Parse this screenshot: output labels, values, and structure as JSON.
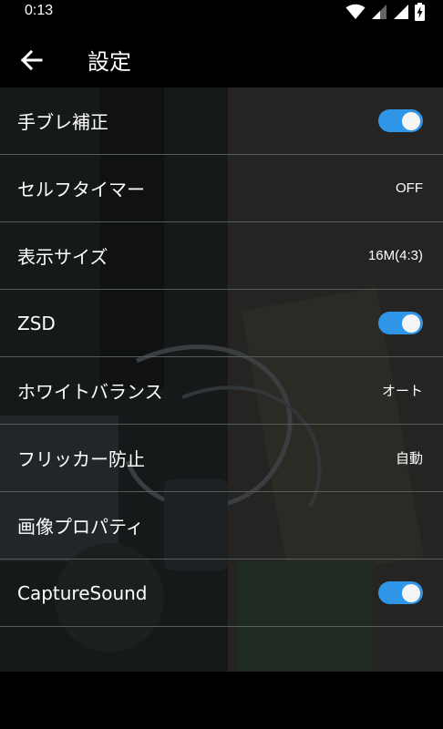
{
  "status_bar": {
    "time": "0:13",
    "icons": [
      "wifi-icon",
      "signal-icon",
      "signal-full-icon",
      "battery-charging-icon"
    ]
  },
  "app_bar": {
    "back_icon": "arrow-left-icon",
    "title": "設定"
  },
  "settings": [
    {
      "label": "手ブレ補正",
      "type": "toggle",
      "on": true
    },
    {
      "label": "セルフタイマー",
      "type": "value",
      "value": "OFF"
    },
    {
      "label": "表示サイズ",
      "type": "value",
      "value": "16M(4:3)"
    },
    {
      "label": "ZSD",
      "type": "toggle",
      "on": true
    },
    {
      "label": "ホワイトバランス",
      "type": "value",
      "value": "オート"
    },
    {
      "label": "フリッカー防止",
      "type": "value",
      "value": "自動"
    },
    {
      "label": "画像プロパティ",
      "type": "none"
    },
    {
      "label": "CaptureSound",
      "type": "toggle",
      "on": true
    }
  ],
  "colors": {
    "toggle_on": "#2f95e8",
    "divider": "#555d5a",
    "background": "#000000"
  }
}
